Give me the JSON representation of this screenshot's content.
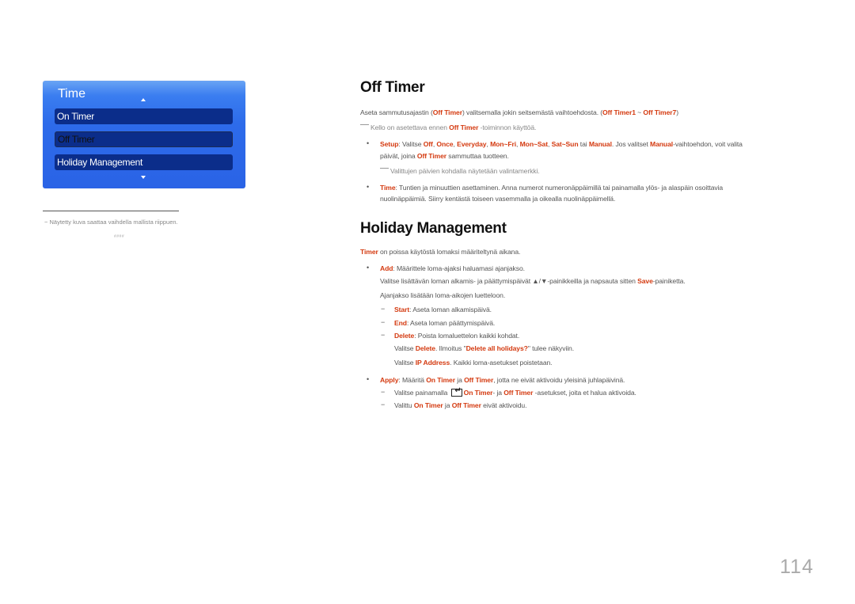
{
  "osd_menu": {
    "title": "Time",
    "items": [
      {
        "label": "On Timer",
        "selected": false
      },
      {
        "label": "Off Timer",
        "selected": true
      },
      {
        "label": "Holiday Management",
        "selected": false
      }
    ]
  },
  "left_footnote": {
    "text": "Näytetty kuva saattaa vaihdella mallista riippuen.",
    "dash": "−",
    "code": "####"
  },
  "off_timer": {
    "heading": "Off Timer",
    "intro": {
      "t1": "Aseta sammutusajastin (",
      "hl1": "Off Timer",
      "t2": ") valitsemalla jokin seitsemästä vaihtoehdosta. (",
      "hl2": "Off Timer1",
      "t3": " ~ ",
      "hl3": "Off Timer7",
      "t4": ")"
    },
    "note1": {
      "t1": "Kello on asetettava ennen ",
      "hl1": "Off Timer",
      "t2": " -toiminnon käyttöä."
    },
    "setup": {
      "hl_label": "Setup",
      "t1": ": Valitse ",
      "opts": [
        "Off",
        "Once",
        "Everyday",
        "Mon~Fri",
        "Mon~Sat",
        "Sat~Sun"
      ],
      "t_tai": " tai ",
      "opt_manual": "Manual",
      "t2": ". Jos valitset ",
      "hl_manual2": "Manual",
      "t3": "-vaihtoehdon, voit valita",
      "line2_t1": "päivät, joina ",
      "line2_hl": "Off Timer",
      "line2_t2": " sammuttaa tuotteen.",
      "note": "Valittujen päivien kohdalla näytetään valintamerkki."
    },
    "time": {
      "hl_label": "Time",
      "t1": ": Tuntien ja minuuttien asettaminen. Anna numerot numeronäppäimillä tai painamalla ylös- ja alaspäin osoittavia",
      "line2": "nuolinäppäimiä. Siirry kentästä toiseen vasemmalla ja oikealla nuolinäppäimellä."
    }
  },
  "holiday": {
    "heading": "Holiday Management",
    "intro": {
      "hl": "Timer",
      "t": " on poissa käytöstä lomaksi määriteltynä aikana."
    },
    "add": {
      "hl_label": "Add",
      "t1": ": Määrittele loma-ajaksi haluamasi ajanjakso.",
      "line2_t1": "Valitse lisättävän loman alkamis- ja päättymispäivät ▲/▼-painikkeilla ja napsauta sitten ",
      "line2_hl": "Save",
      "line2_t2": "-painiketta.",
      "line3": "Ajanjakso lisätään loma-aikojen luetteloon.",
      "start": {
        "hl": "Start",
        "t": ": Aseta loman alkamispäivä."
      },
      "end": {
        "hl": "End",
        "t": ": Aseta loman päättymispäivä."
      },
      "delete": {
        "hl": "Delete",
        "t": ": Poista lomaluettelon kaikki kohdat."
      },
      "delete_l2": {
        "t1": "Valitse ",
        "hl1": "Delete",
        "t2": ". Ilmoitus \"",
        "hl2": "Delete all holidays?",
        "t3": "\" tulee näkyviin."
      },
      "delete_l3": {
        "t1": "Valitse ",
        "hl1": "IP Address",
        "t2": ". Kaikki loma-asetukset poistetaan."
      }
    },
    "apply": {
      "hl_label": "Apply",
      "t1": ": Määritä ",
      "hl1": "On Timer",
      "t2": " ja ",
      "hl2": "Off Timer",
      "t3": ", jotta ne eivät aktivoidu yleisinä juhlapäivinä.",
      "sub1": {
        "t1": "Valitse painamalla ",
        "icon": "enter-icon",
        "hl1": "On Timer",
        "t2": "- ja ",
        "hl2": "Off Timer",
        "t3": " -asetukset, joita et halua aktivoida."
      },
      "sub2": {
        "t1": "Valittu ",
        "hl1": "On Timer",
        "t2": " ja ",
        "hl2": "Off Timer",
        "t3": " eivät aktivoidu."
      }
    }
  },
  "bullet_char": "•",
  "dash_char": "−",
  "page_number": "114",
  "colors": {
    "highlight": "#d43a10",
    "osd_blue": "#2d6bea",
    "osd_item": "#0b2d8a"
  }
}
